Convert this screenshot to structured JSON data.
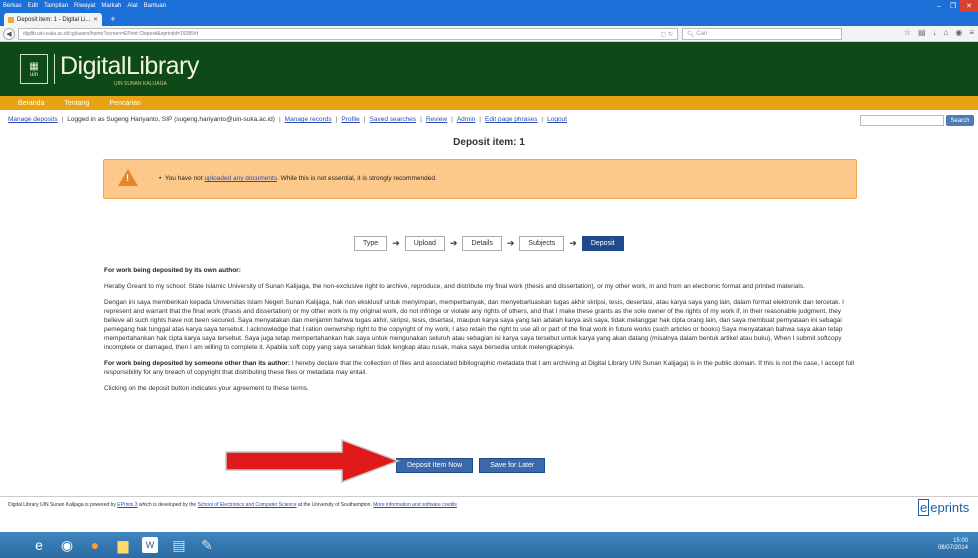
{
  "browser": {
    "menu": [
      "Berkas",
      "Edit",
      "Tampilan",
      "Riwayat",
      "Markah",
      "Alat",
      "Bantuan"
    ],
    "tab_title": "Deposit item: 1 - Digital Li...",
    "url": "digilib.uin-suka.ac.id/cgi/users/home?screen=EPrint::Deposit&eprintid=19285#t",
    "search_placeholder": "Cari"
  },
  "site": {
    "logo_text": "DigitalLibrary",
    "logo_sub": "UIN SUNAN KALIJAGA",
    "nav": [
      "Beranda",
      "Tentang",
      "Pencarian"
    ]
  },
  "userbar": {
    "manage_deposits": "Manage deposits",
    "logged_in": "Logged in as Sugeng Hariyanto, SIP (sugeng.hariyanto@uin-suka.ac.id)",
    "links": [
      "Manage records",
      "Profile",
      "Saved searches",
      "Review",
      "Admin",
      "Edit page phrases",
      "Logout"
    ],
    "search_button": "Search"
  },
  "page": {
    "title": "Deposit item: 1",
    "warning_pre": "You have not",
    "warning_link": "uploaded any documents",
    "warning_post": ". While this is not essential, it is strongly recommended.",
    "steps": [
      "Type",
      "Upload",
      "Details",
      "Subjects",
      "Deposit"
    ]
  },
  "agreement": {
    "heading1": "For work being deposited by its own author:",
    "para1": "Heraby Greant to my school: State Islamic University of Sunan Kalijaga, the non-exclusive right to archive, reproduce, and distribute my final work (thesis and dissertation), or my other work, in and from an electronic format and printed materials.",
    "para2": "Dengan ini saya memberikan kepada Universitas Islam Negeri Sunan Kalijaga, hak non eksklusif untuk menyimpan, memperbanyak, dan menyebarluaskan tugas akhir skripsi, tesis, desertasi, atau karya saya yang lain, dalam format elektronik dan tercetak. I represent and warrant that the final work (thasis and dissertation) or my other work is my original work, do not infringe or violate any rights of others, and that I make these grants as the sole owner of the rights of my work if, in their reasonable judgment, they believe all such rights have not been secured. Saya menyatakan dan menjamin bahwa tugas akhir, skripsi, tesis, disertasi, maupun karya saya yang lain adalah karya asli saya, tidak melanggar hak cipta orang lain, dan saya membuat pernyataan ini sebagai pemegang hak tunggal atas karya saya tersebut. I acknowledge that I ration ownwrship right to the copyright of my work, I also retain the right to use all or part of the final work in future works (such articles or books) Saya menyatakan bahwa saya akan tetap mempertahankan hak cipta karya saya tersebut. Saya juga tetap mempertahankan hak saya untuk mengunakan seluruh atau sebagian isi karya saya tersebut untuk karya yang akan datang (misalnya dalam bentuk artikel atau buku), When I submit softcopy incomplete or damaged, then I am willing to complete it. Apabila soft copy yang saya serahkan tidak lengkap atau rusak, maka saya bersedia untuk melengkapinya.",
    "heading2": "For work being deposited by someone other than its author:",
    "para3": "I hereby declare that the collection of files and associated bibliographic metadata that I am archiving at Digital Library UIN Sunan Kalijaga) is in the public domain. If this is not the case, I accept full responsibility for any breach of copyright that distributing these files or metadata may entail.",
    "para4": "Clicking on the deposit button indicates your agreement to these terms.",
    "deposit_button": "Deposit Item Now",
    "save_button": "Save for Later"
  },
  "footer": {
    "t1": "Digital Library UIN Sunan Kalijaga is powered by",
    "l1": "EPrints 3",
    "t2": "which is developed by the",
    "l2": "School of Electronics and Computer Science",
    "t3": "at the University of Southampton.",
    "l3": "More information and software credits",
    "logo": "eprints"
  },
  "taskbar": {
    "clock_time": "15:00",
    "clock_date": "08/07/2014"
  }
}
